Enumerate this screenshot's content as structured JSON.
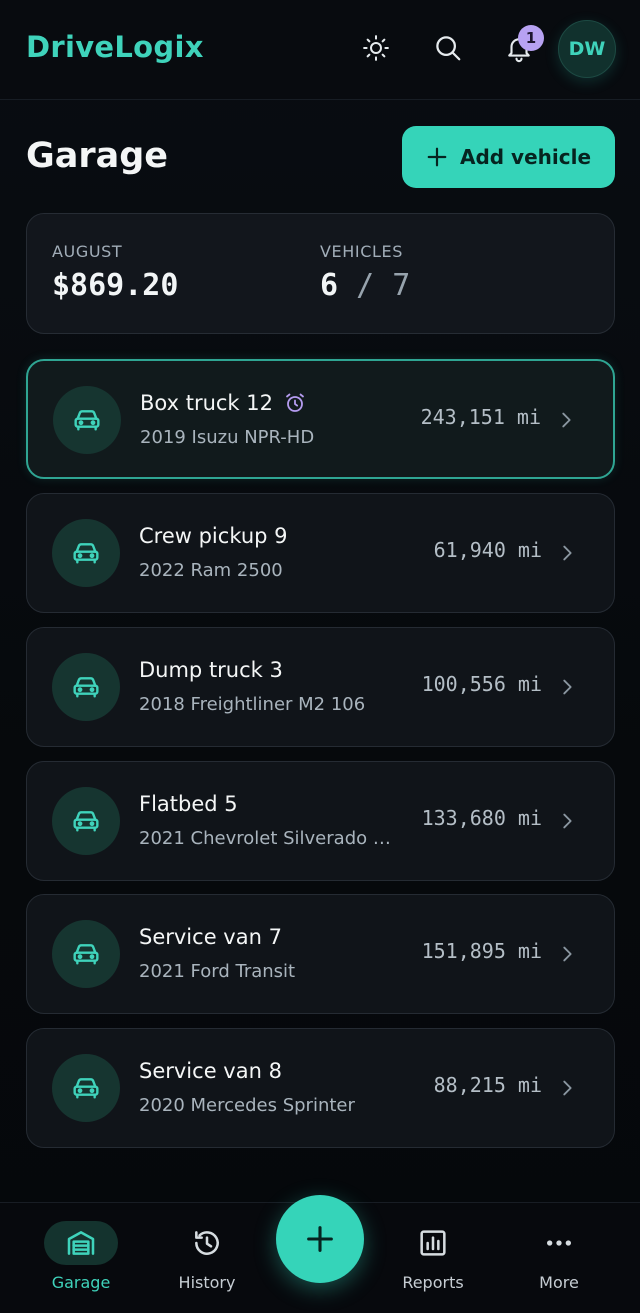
{
  "header": {
    "brand": "DriveLogix",
    "notification_count": "1",
    "avatar_initials": "DW"
  },
  "page": {
    "title": "Garage",
    "add_button_label": "Add vehicle"
  },
  "summary": {
    "month_label": "AUGUST",
    "month_cost": "$869.20",
    "vehicles_label": "VEHICLES",
    "vehicles_used": "6",
    "vehicles_separator": "/",
    "vehicles_limit": "7"
  },
  "vehicles": [
    {
      "name": "Box truck 12",
      "model": "2019 Isuzu NPR-HD",
      "mileage": "243,151 mi",
      "has_reminder": true,
      "selected": true
    },
    {
      "name": "Crew pickup 9",
      "model": "2022 Ram 2500",
      "mileage": "61,940 mi",
      "has_reminder": false,
      "selected": false
    },
    {
      "name": "Dump truck 3",
      "model": "2018 Freightliner M2 106",
      "mileage": "100,556 mi",
      "has_reminder": false,
      "selected": false
    },
    {
      "name": "Flatbed 5",
      "model": "2021 Chevrolet Silverado …",
      "mileage": "133,680 mi",
      "has_reminder": false,
      "selected": false
    },
    {
      "name": "Service van 7",
      "model": "2021 Ford Transit",
      "mileage": "151,895 mi",
      "has_reminder": false,
      "selected": false
    },
    {
      "name": "Service van 8",
      "model": "2020 Mercedes Sprinter",
      "mileage": "88,215 mi",
      "has_reminder": false,
      "selected": false
    }
  ],
  "nav": {
    "garage": "Garage",
    "history": "History",
    "reports": "Reports",
    "more": "More",
    "active": "garage"
  },
  "colors": {
    "accent": "#35d4b9",
    "brand": "#3fd3bb",
    "badge": "#b7a2f2",
    "reminder": "#b59cf0",
    "background": "#06090d"
  },
  "icons": {
    "theme": "sun-icon",
    "search": "search-icon",
    "notifications": "bell-icon",
    "vehicle": "car-icon",
    "reminder": "alarm-clock-icon",
    "row_action": "chevron-right-icon",
    "fab": "plus-icon"
  }
}
